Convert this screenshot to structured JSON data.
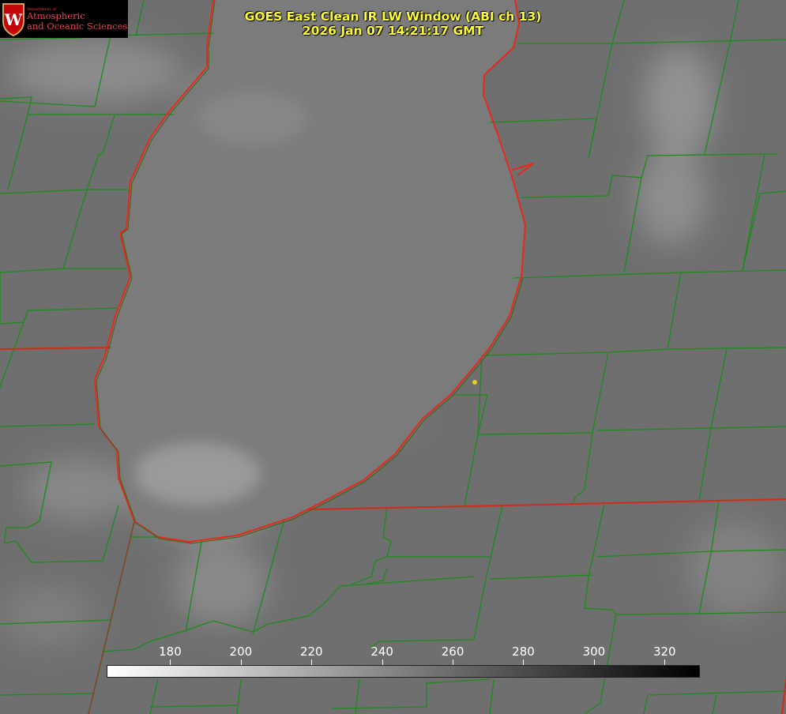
{
  "header": {
    "title_line1": "GOES East Clean IR LW Window (ABI ch 13)",
    "title_line2": "2026 Jan 07 14:21:17 GMT",
    "title_color": "#ffff33"
  },
  "logo": {
    "institution_line1": "Department of",
    "institution_line2": "Atmospheric",
    "institution_line3": "and Oceanic Sciences",
    "crest_letter": "W",
    "brand_color": "#c5050c"
  },
  "colorbar": {
    "ticks": [
      "180",
      "200",
      "220",
      "240",
      "260",
      "280",
      "300",
      "320"
    ],
    "range": [
      162,
      330
    ],
    "gradient": [
      "#ffffff",
      "#000000"
    ]
  },
  "map_style": {
    "county_color": "#1a8c1a",
    "state_color": "#d42a1a",
    "lake_color": "#7b7b7b",
    "land_color": "#6f6f6f",
    "marker_color": "#e0d020"
  }
}
